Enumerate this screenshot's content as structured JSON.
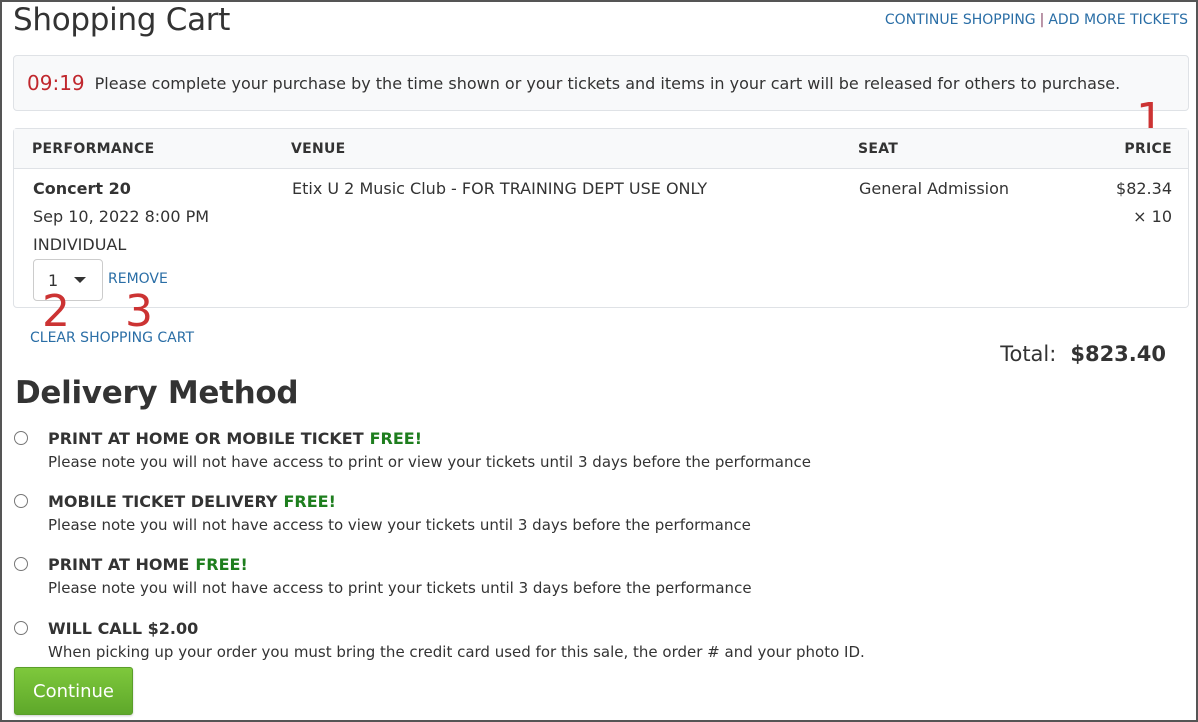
{
  "header": {
    "title": "Shopping Cart",
    "links": [
      "CONTINUE SHOPPING",
      "ADD MORE TICKETS"
    ],
    "separator": "|"
  },
  "timer": {
    "time": "09:19",
    "message": "Please complete your purchase by the time shown or your tickets and items in your cart will be released for others to purchase."
  },
  "annotations": [
    "1",
    "2",
    "3"
  ],
  "cart": {
    "columns": [
      "PERFORMANCE",
      "VENUE",
      "SEAT",
      "PRICE"
    ],
    "items": [
      {
        "performance": "Concert 20",
        "date": "Sep 10, 2022 8:00 PM",
        "ticket_type": "INDIVIDUAL",
        "quantity": "1",
        "remove_label": "REMOVE",
        "venue": "Etix U 2 Music Club - FOR TRAINING DEPT USE ONLY",
        "seat": "General Admission",
        "price": "$82.34",
        "multiplier": "× 10"
      }
    ],
    "clear_label": "CLEAR SHOPPING CART",
    "total_label": "Total:",
    "total_value": "$823.40"
  },
  "delivery": {
    "title": "Delivery Method",
    "options": [
      {
        "label": "PRINT AT HOME OR MOBILE TICKET",
        "price": "FREE!",
        "note": "Please note you will not have access to print or view your tickets until 3 days before the performance"
      },
      {
        "label": "MOBILE TICKET DELIVERY",
        "price": "FREE!",
        "note": "Please note you will not have access to view your tickets until 3 days before the performance"
      },
      {
        "label": "PRINT AT HOME",
        "price": "FREE!",
        "note": "Please note you will not have access to print your tickets until 3 days before the performance"
      },
      {
        "label": "WILL CALL $2.00",
        "price": "",
        "note": "When picking up your order you must bring the credit card used for this sale, the order # and your photo ID."
      }
    ]
  },
  "continue_label": "Continue",
  "colors": {
    "link": "#2a6ea6",
    "timer": "#c0272d",
    "free": "#1e7e1e",
    "button": "#6cb833",
    "annotation": "#cc3333"
  }
}
